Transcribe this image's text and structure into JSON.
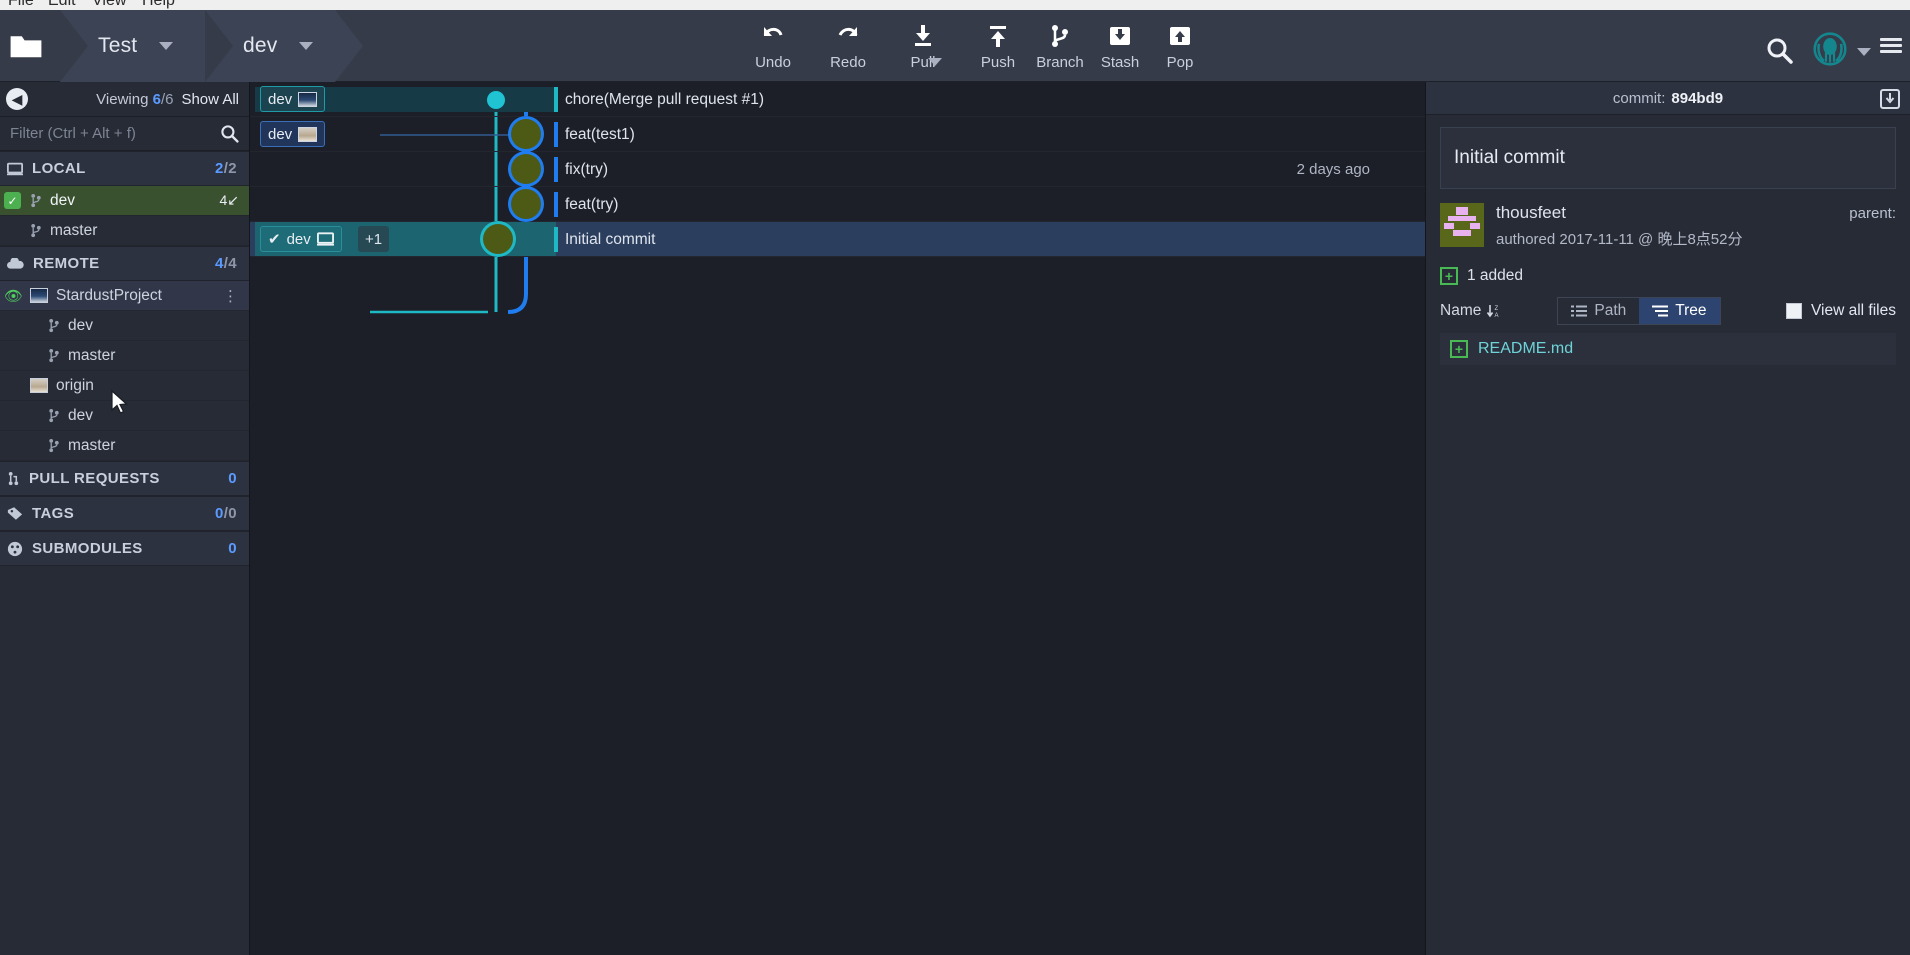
{
  "menubar": {
    "items": [
      "File",
      "Edit",
      "View",
      "Help"
    ]
  },
  "toolbar": {
    "repo_icon": "folder-icon",
    "repo_name": "Test",
    "branch_name": "dev",
    "actions": [
      {
        "name": "undo",
        "label": "Undo",
        "icon": "undo-arrow-icon"
      },
      {
        "name": "redo",
        "label": "Redo",
        "icon": "redo-arrow-icon"
      },
      {
        "name": "pull",
        "label": "Pull",
        "icon": "pull-down-arrow-icon"
      },
      {
        "name": "push",
        "label": "Push",
        "icon": "push-up-arrow-icon"
      },
      {
        "name": "branch",
        "label": "Branch",
        "icon": "git-branch-icon"
      },
      {
        "name": "stash",
        "label": "Stash",
        "icon": "stash-box-down-icon"
      },
      {
        "name": "pop",
        "label": "Pop",
        "icon": "pop-box-up-icon"
      }
    ],
    "search_icon": "search-icon",
    "account_icon": "kraken-avatar-icon",
    "menu_icon": "hamburger-menu-icon"
  },
  "sidebar": {
    "back_icon": "chevron-left-icon",
    "viewing_label": "Viewing",
    "viewing_current": "6",
    "viewing_total": "/6",
    "show_all_label": "Show All",
    "filter_placeholder": "Filter (Ctrl + Alt + f)",
    "filter_value": "",
    "filter_icon": "search-icon",
    "sections": [
      {
        "name": "local",
        "icon": "monitor-icon",
        "label": "LOCAL",
        "count_current": "2",
        "count_total": "/2",
        "rows": [
          {
            "name": "branch-dev",
            "icon": "git-branch-icon",
            "label": "dev",
            "count": "4↙",
            "state": "active-checked"
          },
          {
            "name": "branch-master",
            "icon": "git-branch-icon",
            "label": "master",
            "count": "",
            "state": "normal"
          }
        ]
      },
      {
        "name": "remote",
        "icon": "cloud-icon",
        "label": "REMOTE",
        "count_current": "4",
        "count_total": "/4",
        "rows": [
          {
            "name": "remote-stardustproject",
            "icon": "remote-avatar-stardust",
            "label": "StardustProject",
            "count": "",
            "state": "hovered"
          },
          {
            "name": "remote-stardust-dev",
            "icon": "git-branch-icon",
            "label": "dev",
            "count": "",
            "state": "normal"
          },
          {
            "name": "remote-stardust-master",
            "icon": "git-branch-icon",
            "label": "master",
            "count": "",
            "state": "normal"
          },
          {
            "name": "remote-origin",
            "icon": "remote-avatar-origin",
            "label": "origin",
            "count": "",
            "state": "normal"
          },
          {
            "name": "remote-origin-dev",
            "icon": "git-branch-icon",
            "label": "dev",
            "count": "",
            "state": "normal"
          },
          {
            "name": "remote-origin-master",
            "icon": "git-branch-icon",
            "label": "master",
            "count": "",
            "state": "normal"
          }
        ]
      },
      {
        "name": "pull-requests",
        "icon": "pull-request-icon",
        "label": "PULL REQUESTS",
        "count_current": "0",
        "count_total": "",
        "rows": []
      },
      {
        "name": "tags",
        "icon": "tag-icon",
        "label": "TAGS",
        "count_current": "0",
        "count_total": "/0",
        "rows": []
      },
      {
        "name": "submodules",
        "icon": "submodule-icon",
        "label": "SUBMODULES",
        "count_current": "0",
        "count_total": "",
        "rows": []
      }
    ]
  },
  "graph": {
    "commits": [
      {
        "name": "commit-chore-merge",
        "message": "chore(Merge pull request #1)",
        "when": "",
        "node": "dot",
        "lane_color": "#1fb9c6",
        "selected": false,
        "refs": [
          {
            "name": "ref-dev-stardust",
            "label": "dev",
            "avatar": "stardust",
            "border": "#1f9aa6",
            "bg": "#1b4450"
          }
        ]
      },
      {
        "name": "commit-feat-test1",
        "message": "feat(test1)",
        "when": "",
        "node": "avatar-blue",
        "lane_color": "#1f7df0",
        "selected": false,
        "refs": [
          {
            "name": "ref-dev-origin",
            "label": "dev",
            "avatar": "origin",
            "border": "#3a6fb8",
            "bg": "#21355a"
          }
        ]
      },
      {
        "name": "commit-fix-try",
        "message": "fix(try)",
        "when": "2 days ago",
        "node": "avatar-blue",
        "lane_color": "#1f7df0",
        "selected": false,
        "refs": []
      },
      {
        "name": "commit-feat-try",
        "message": "feat(try)",
        "when": "",
        "node": "avatar-blue",
        "lane_color": "#1f7df0",
        "selected": false,
        "refs": []
      },
      {
        "name": "commit-initial",
        "message": "Initial commit",
        "when": "",
        "node": "avatar-teal",
        "lane_color": "#1fb9c6",
        "selected": true,
        "refs": [
          {
            "name": "ref-dev-local",
            "label": "dev",
            "avatar": "monitor",
            "border": "#2a8f9c",
            "bg": "#1e6c77",
            "check": "✔"
          }
        ],
        "extra_refs_label": "+1"
      }
    ]
  },
  "detail": {
    "commit_label": "commit:",
    "commit_sha": "894bd9",
    "panel_icon": "open-in-panel-icon",
    "message": "Initial commit",
    "author_name": "thousfeet",
    "authored_text": "authored 2017-11-11 @ 晚上8点52分",
    "parent_label": "parent:",
    "changes_summary": "1 added",
    "sort_label": "Name",
    "sort_icon": "sort-za-icon",
    "view_modes": [
      {
        "name": "view-mode-path",
        "label": "Path",
        "icon": "list-icon",
        "active": false
      },
      {
        "name": "view-mode-tree",
        "label": "Tree",
        "icon": "tree-icon",
        "active": true
      }
    ],
    "view_all_files_label": "View all files",
    "view_all_files_checked": false,
    "files": [
      {
        "name": "file-readme",
        "label": "README.md",
        "status": "added",
        "status_icon": "plus-box-icon"
      }
    ]
  },
  "colors": {
    "accent_blue": "#1f7df0",
    "accent_teal": "#1fb9c6",
    "green_active": "#39512f",
    "selected_row": "#2b3e5e",
    "panel_bg": "#272b36",
    "graph_bg": "#1c1f27"
  }
}
